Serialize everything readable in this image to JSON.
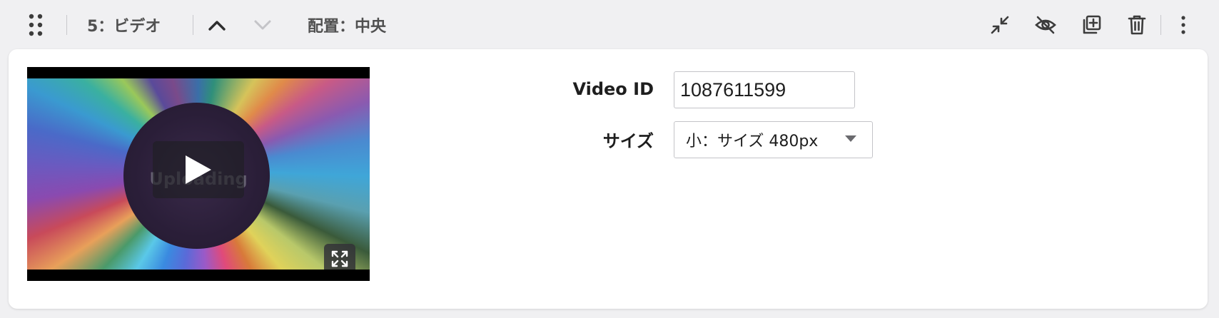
{
  "toolbar": {
    "block_label": "5：ビデオ",
    "alignment_label": "配置：中央",
    "icons": [
      "drag-handle-icon",
      "chevron-up-icon",
      "chevron-down-icon",
      "collapse-icon",
      "hide-icon",
      "duplicate-icon",
      "trash-icon",
      "more-vertical-icon"
    ]
  },
  "video": {
    "overlay_text": "Uploading"
  },
  "form": {
    "video_id_label": "Video ID",
    "video_id_value": "1087611599",
    "size_label": "サイズ",
    "size_value": "小：サイズ 480px"
  },
  "colors": {
    "background": "#f0f0f2",
    "card": "#ffffff",
    "icon": "#3c3c3c",
    "disabled_icon": "#c0c0c4"
  }
}
